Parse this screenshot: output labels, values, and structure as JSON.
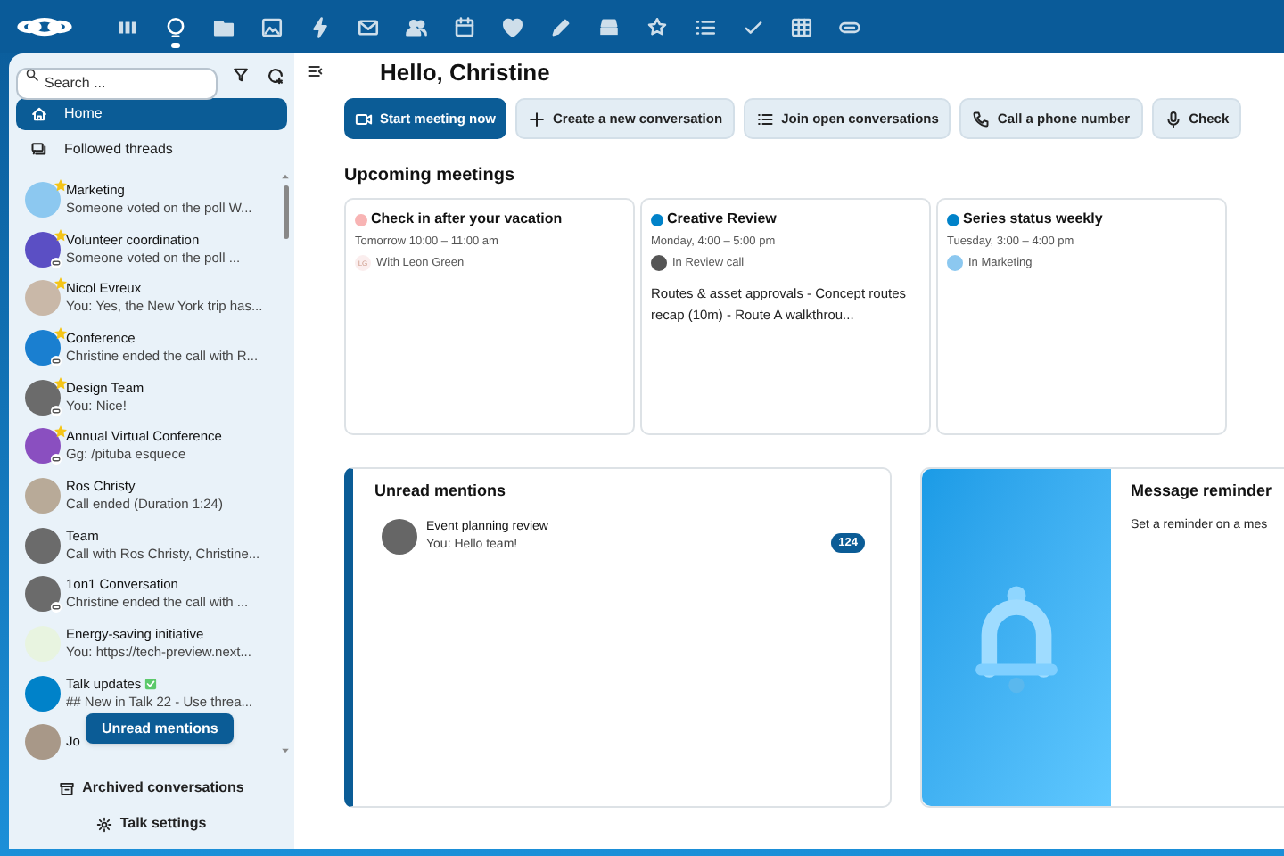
{
  "app_bar": [
    {
      "kind": "dashboard",
      "selected": false
    },
    {
      "kind": "talk",
      "selected": true
    },
    {
      "kind": "files",
      "selected": false
    },
    {
      "kind": "photos",
      "selected": false
    },
    {
      "kind": "activity",
      "selected": false
    },
    {
      "kind": "mail",
      "selected": false
    },
    {
      "kind": "contacts",
      "selected": false
    },
    {
      "kind": "calendar",
      "selected": false
    },
    {
      "kind": "heart",
      "selected": false
    },
    {
      "kind": "pencil",
      "selected": false
    },
    {
      "kind": "deck",
      "selected": false
    },
    {
      "kind": "star",
      "selected": false
    },
    {
      "kind": "list",
      "selected": false
    },
    {
      "kind": "check",
      "selected": false
    },
    {
      "kind": "table",
      "selected": false
    },
    {
      "kind": "link",
      "selected": false
    }
  ],
  "sidebar": {
    "search": {
      "placeholder": "Search ..."
    },
    "nav": [
      {
        "kind": "home",
        "label": "Home",
        "selected": true
      },
      {
        "kind": "threads",
        "label": "Followed threads",
        "selected": false
      }
    ],
    "conversations": [
      {
        "name": "Marketing",
        "message": "Someone voted on the poll W...",
        "color": "#8cc8f0",
        "favorite": true,
        "guest_link": false,
        "verified": false
      },
      {
        "name": "Volunteer coordination",
        "message": "Someone voted on the poll ...",
        "color": "#5b4fc4",
        "favorite": true,
        "guest_link": true,
        "verified": false
      },
      {
        "name": "Nicol Evreux",
        "message": "You: Yes, the New York trip has...",
        "color": "#c9b8a8",
        "favorite": true,
        "guest_link": false,
        "verified": false
      },
      {
        "name": "Conference",
        "message": "Christine ended the call with R...",
        "color": "#1a7fd0",
        "favorite": true,
        "guest_link": true,
        "verified": false
      },
      {
        "name": "Design Team",
        "message": "You: Nice!",
        "color": "#6b6b6b",
        "favorite": true,
        "guest_link": true,
        "verified": false
      },
      {
        "name": "Annual Virtual Conference",
        "message": "Gg: /pituba esquece",
        "color": "#8a4fc0",
        "favorite": true,
        "guest_link": true,
        "verified": false
      },
      {
        "name": "Ros Christy",
        "message": "Call ended (Duration 1:24)",
        "color": "#b8aa98",
        "favorite": false,
        "guest_link": false,
        "verified": false
      },
      {
        "name": "Team",
        "message": "Call with Ros Christy, Christine...",
        "color": "#6b6b6b",
        "favorite": false,
        "guest_link": false,
        "verified": false
      },
      {
        "name": "1on1 Conversation",
        "message": "Christine ended the call with ...",
        "color": "#6b6b6b",
        "favorite": false,
        "guest_link": true,
        "verified": false
      },
      {
        "name": "Energy-saving initiative",
        "message": "You: https://tech-preview.next...",
        "color": "#e8f4e0",
        "favorite": false,
        "guest_link": false,
        "verified": false
      },
      {
        "name": "Talk updates",
        "message": "## New in Talk 22 - Use threa...",
        "color": "#0082c9",
        "favorite": false,
        "guest_link": false,
        "verified": true
      },
      {
        "name": "Jo",
        "color": "#a89888",
        "favorite": false,
        "guest_link": false,
        "verified": false
      }
    ],
    "unread_button": "Unread mentions",
    "footer": [
      {
        "kind": "archive",
        "label": "Archived conversations"
      },
      {
        "kind": "settings",
        "label": "Talk settings"
      }
    ]
  },
  "main": {
    "greeting": "Hello, Christine",
    "actions": [
      {
        "kind": "video",
        "label": "Start meeting now",
        "primary": true
      },
      {
        "kind": "plus",
        "label": "Create a new conversation",
        "primary": false
      },
      {
        "kind": "list",
        "label": "Join open conversations",
        "primary": false
      },
      {
        "kind": "phone",
        "label": "Call a phone number",
        "primary": false
      },
      {
        "kind": "mic",
        "label": "Check",
        "primary": false
      }
    ],
    "upcoming_title": "Upcoming meetings",
    "meetings": [
      {
        "title": "Check in after your vacation",
        "color": "#f8b4b4",
        "time": "Tomorrow 10:00 – 11:00 am",
        "location": "With Leon Green",
        "initials": "LG"
      },
      {
        "title": "Creative Review",
        "color": "#0082c9",
        "time": "Monday, 4:00 – 5:00 pm",
        "location": "In Review call",
        "description": "Routes & asset approvals - Concept routes recap (10m) - Route A walkthrou..."
      },
      {
        "title": "Series status weekly",
        "color": "#0082c9",
        "time": "Tuesday, 3:00 – 4:00 pm",
        "location": "In Marketing"
      }
    ],
    "mentions": {
      "title": "Unread mentions",
      "items": [
        {
          "name": "Event planning review",
          "message": "You: Hello team!",
          "count": "124"
        }
      ]
    },
    "reminder": {
      "title": "Message reminder",
      "text": "Set a reminder on a mes"
    }
  }
}
